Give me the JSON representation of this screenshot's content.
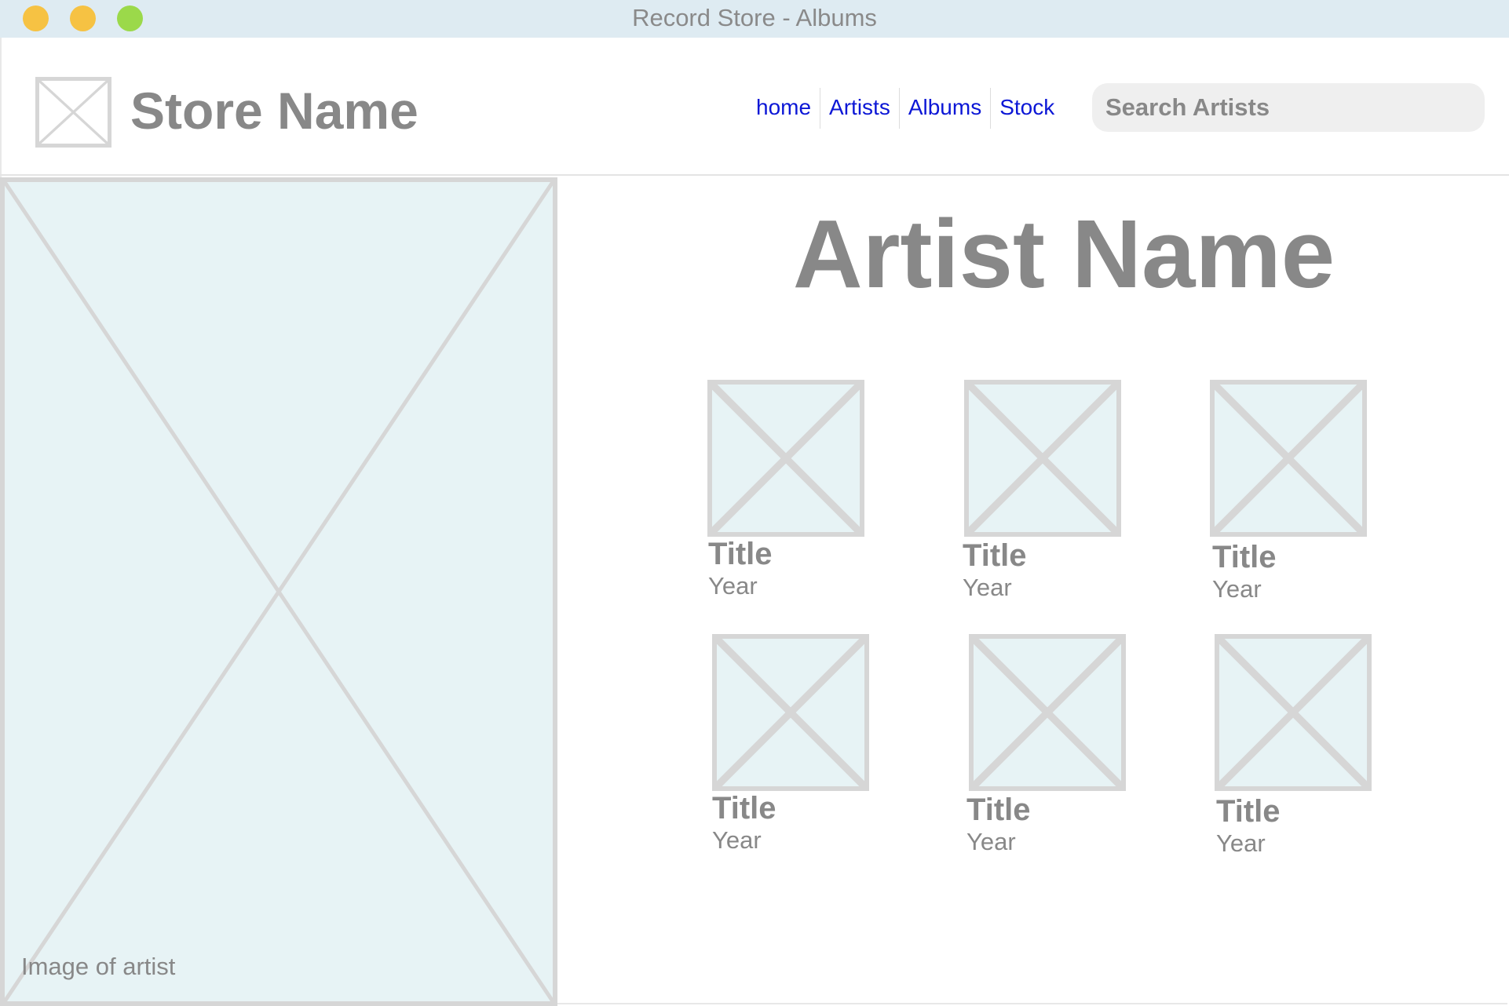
{
  "window": {
    "title": "Record Store - Albums"
  },
  "header": {
    "store_name": "Store Name",
    "logo_icon": "image-placeholder-icon",
    "nav": [
      "home",
      "Artists",
      "Albums",
      "Stock"
    ],
    "search_placeholder": "Search Artists"
  },
  "artist_panel": {
    "caption": "Image of artist"
  },
  "main": {
    "artist_name": "Artist Name",
    "albums": [
      {
        "title": "Title",
        "year": "Year"
      },
      {
        "title": "Title",
        "year": "Year"
      },
      {
        "title": "Title",
        "year": "Year"
      },
      {
        "title": "Title",
        "year": "Year"
      },
      {
        "title": "Title",
        "year": "Year"
      },
      {
        "title": "Title",
        "year": "Year"
      }
    ]
  },
  "colors": {
    "nav_link": "#0c17d6",
    "placeholder_fill": "#e7f3f5",
    "placeholder_border": "#d6d6d6",
    "text_gray": "#888888",
    "titlebar": "#deebf2"
  }
}
